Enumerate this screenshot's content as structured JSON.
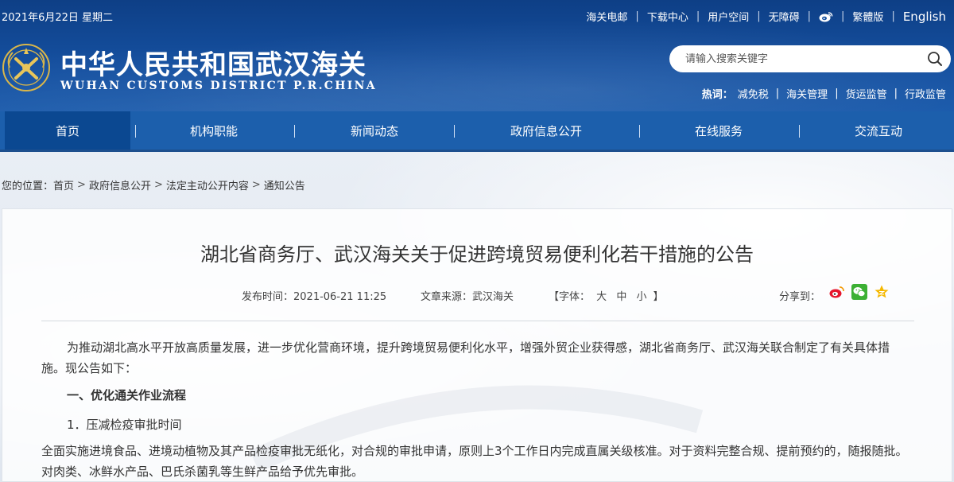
{
  "header": {
    "date": "2021年6月22日 星期二",
    "top_links": [
      "海关电邮",
      "下载中心",
      "用户空间",
      "无障碍"
    ],
    "lang_traditional": "繁體版",
    "lang_english": "English",
    "title": "中华人民共和国武汉海关",
    "subtitle": "WUHAN CUSTOMS DISTRICT P.R.CHINA",
    "search_placeholder": "请输入搜索关键字",
    "hot_label": "热词：",
    "hot_words": [
      "减免税",
      "海关管理",
      "货运监管",
      "行政监管"
    ]
  },
  "nav": {
    "items": [
      "首页",
      "机构职能",
      "新闻动态",
      "政府信息公开",
      "在线服务",
      "交流互动"
    ],
    "separator": "|"
  },
  "breadcrumb": {
    "label": "您的位置：",
    "items": [
      "首页",
      "政府信息公开",
      "法定主动公开内容",
      "通知公告"
    ],
    "arrow": ">"
  },
  "article": {
    "title": "湖北省商务厅、武汉海关关于促进跨境贸易便利化若干措施的公告",
    "publish_time": "发布时间：2021-06-21 11:25",
    "source": "文章来源：武汉海关",
    "font_label": "【字体：",
    "font_sizes": [
      "大",
      "中",
      "小"
    ],
    "font_close": "】",
    "share_label": "分享到：",
    "intro": "为推动湖北高水平开放高质量发展，进一步优化营商环境，提升跨境贸易便利化水平，增强外贸企业获得感，湖北省商务厅、武汉海关联合制定了有关具体措施。现公告如下：",
    "section1": "一、优化通关作业流程",
    "subsection1": "1．压减检疫审批时间",
    "paragraph1": "全面实施进境食品、进境动植物及其产品检疫审批无纸化，对合规的审批申请，原则上3个工作日内完成直属关级核准。对于资料完整合规、提前预约的，随报随批。对肉类、冰鲜水产品、巴氏杀菌乳等生鲜产品给予优先审批。"
  },
  "colors": {
    "header_blue": "#0e3f86",
    "nav_blue": "#1c5fac",
    "nav_active": "#0b4891"
  }
}
